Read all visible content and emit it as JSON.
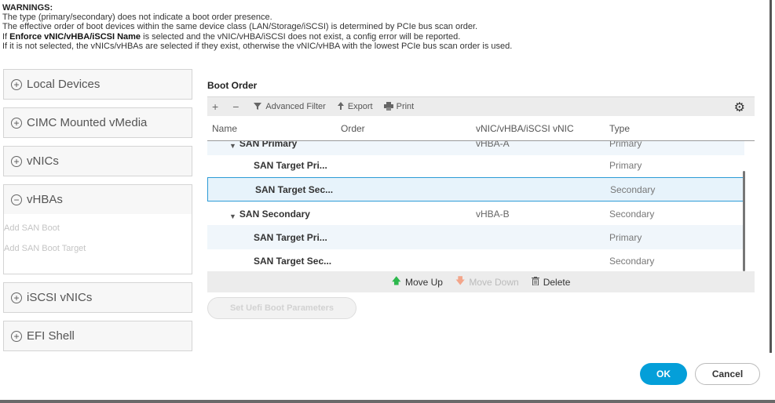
{
  "warnings": {
    "title": "WARNINGS:",
    "line1": "The type (primary/secondary) does not indicate a boot order presence.",
    "line2": "The effective order of boot devices within the same device class (LAN/Storage/iSCSI) is determined by PCIe bus scan order.",
    "line3_pre": "If ",
    "line3_bold": "Enforce vNIC/vHBA/iSCSI Name",
    "line3_post": " is selected and the vNIC/vHBA/iSCSI does not exist, a config error will be reported.",
    "line4": "If it is not selected, the vNICs/vHBAs are selected if they exist, otherwise the vNIC/vHBA with the lowest PCIe bus scan order is used."
  },
  "left_panels": {
    "local_devices": "Local Devices",
    "cimc_vmedia": "CIMC Mounted vMedia",
    "vnics": "vNICs",
    "vhbas": "vHBAs",
    "vhbas_links": [
      "Add SAN Boot",
      "Add SAN Boot Target"
    ],
    "iscsi_vnics": "iSCSI vNICs",
    "efi_shell": "EFI Shell",
    "plus_symbol": "+",
    "minus_symbol": "−"
  },
  "boot_order": {
    "title": "Boot Order",
    "toolbar": {
      "add": "+",
      "remove": "−",
      "advanced_filter": "Advanced Filter",
      "export": "Export",
      "print": "Print"
    },
    "columns": [
      "Name",
      "Order",
      "vNIC/vHBA/iSCSI vNIC",
      "Type"
    ],
    "rows": [
      {
        "name": "SAN Primary",
        "vnic": "vHBA-A",
        "type": "Primary"
      },
      {
        "name": "SAN Target Pri...",
        "vnic": "",
        "type": "Primary"
      },
      {
        "name": "SAN Target Sec...",
        "vnic": "",
        "type": "Secondary"
      },
      {
        "name": "SAN Secondary",
        "vnic": "vHBA-B",
        "type": "Secondary"
      },
      {
        "name": "SAN Target Pri...",
        "vnic": "",
        "type": "Primary"
      },
      {
        "name": "SAN Target Sec...",
        "vnic": "",
        "type": "Secondary"
      }
    ],
    "actions": {
      "move_up": "Move Up",
      "move_down": "Move Down",
      "delete": "Delete"
    }
  },
  "uefi_button": "Set Uefi Boot Parameters",
  "ok_button": "OK",
  "cancel_button": "Cancel",
  "colors": {
    "accent": "#049fd9",
    "selected_border": "#2c9bd6",
    "move_up_arrow": "#2db84d"
  }
}
